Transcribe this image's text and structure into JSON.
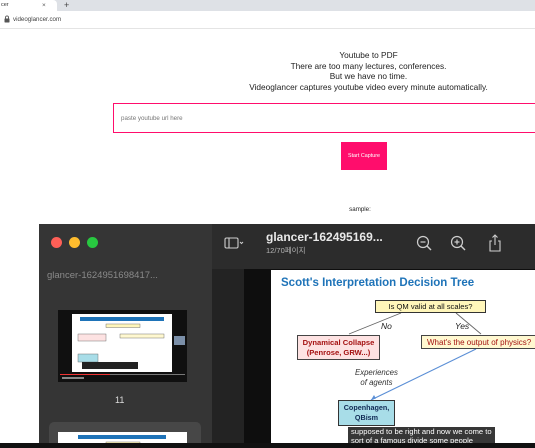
{
  "browser": {
    "tab_title": "cer",
    "tab_close": "×",
    "new_tab": "+",
    "url": "videoglancer.com"
  },
  "hero": {
    "line1": "Youtube to PDF",
    "line2": "There are too many lectures, conferences.",
    "line3": "But we have no time.",
    "line4": "Videoglancer captures youtube video every minute automatically."
  },
  "form": {
    "url_placeholder": "paste youtube url here",
    "start_label": "Start Capture"
  },
  "sample_label": "sample:",
  "preview_app": {
    "sidebar_title": "glancer-1624951698417...",
    "page_number": "11",
    "doc_title": "glancer-162495169...",
    "doc_subtitle": "12/70페이지"
  },
  "slide": {
    "title": "Scott's Interpretation Decision Tree",
    "question": "Is QM valid at all scales?",
    "no_label": "No",
    "yes_label": "Yes",
    "dynamical_line1": "Dynamical Collapse",
    "dynamical_line2": "(Penrose, GRW...)",
    "output_node": "What's the output of physics?",
    "experiences_line1": "Experiences",
    "experiences_line2": "of agents",
    "copenhagen_line1": "Copenhagen,",
    "copenhagen_line2": "QBism",
    "caption_line1": "supposed to be right and now we come to",
    "caption_line2": "sort of a famous divide some people"
  },
  "colors": {
    "accent": "#ff0d6c",
    "slide_title": "#1e73b8",
    "question_fill": "#fff6ba",
    "collapse_fill": "#fde2e2",
    "copenhagen_fill": "#a8dde8"
  }
}
